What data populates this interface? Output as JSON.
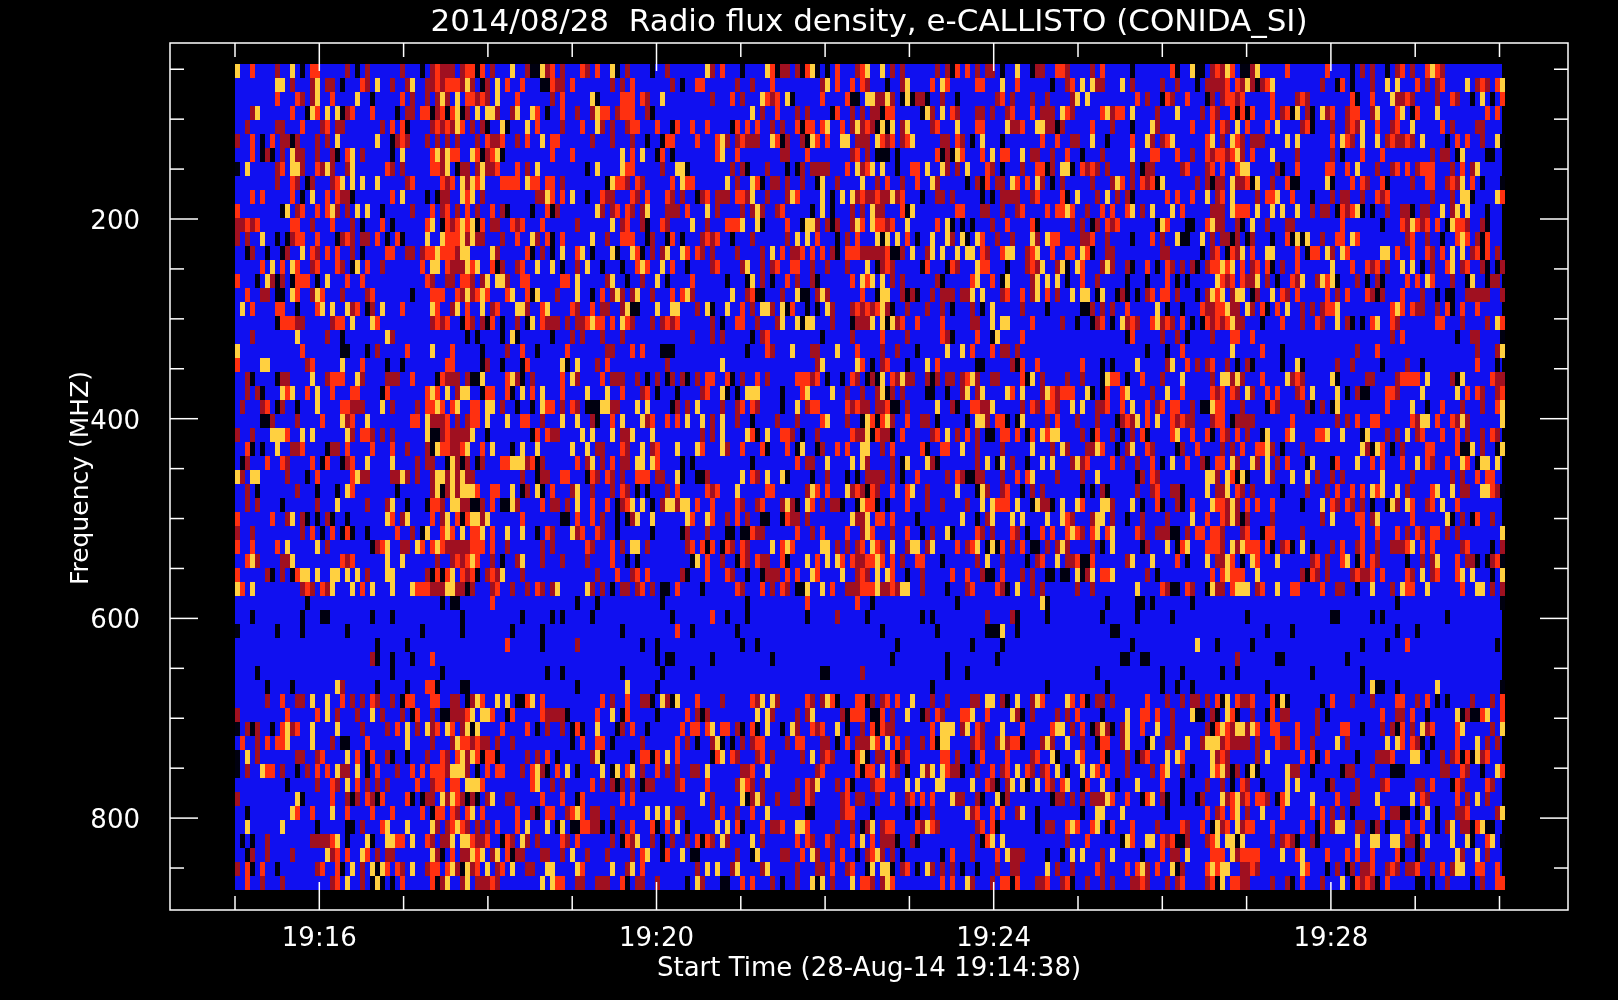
{
  "chart": {
    "title": "2014/08/28  Radio flux density, e-CALLISTO (CONIDA_SI)",
    "ylabel": "Frequency (MHZ)",
    "xlabel": "Start Time (28-Aug-14 19:14:38)",
    "yticks": [
      "200",
      "400",
      "600",
      "800"
    ],
    "xticks": [
      "19:16",
      "19:20",
      "19:24",
      "19:28"
    ]
  }
}
